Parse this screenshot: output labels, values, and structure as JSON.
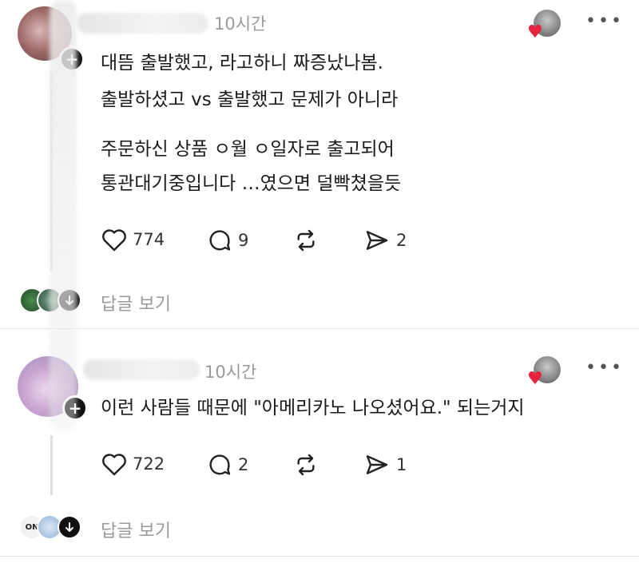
{
  "comments": [
    {
      "time": "10시간",
      "lines": [
        "대뜸 출발했고, 라고하니 짜증났나봄.",
        "출발하셨고 vs 출발했고 문제가 아니라",
        "주문하신 상품 ㅇ월 ㅇ일자로 출고되어",
        "통관대기중입니다 …였으면 덜빡쳤을듯"
      ],
      "likes": "774",
      "replies": "9",
      "shares": "2",
      "reply_link": "답글 보기"
    },
    {
      "time": "10시간",
      "lines": [
        "이런 사람들 때문에 \"아메리카노 나오셨어요.\" 되는거지"
      ],
      "likes": "722",
      "replies": "2",
      "shares": "1",
      "reply_link": "답글 보기",
      "reply_avatar_text": "ON"
    }
  ],
  "icons": {
    "like": "heart-outline-icon",
    "comment": "speech-bubble-icon",
    "repost": "repost-arrows-icon",
    "share": "paper-plane-icon",
    "more": "more-dots-icon",
    "liked": "heart-filled-icon"
  },
  "colors": {
    "heart": "#e8213d",
    "muted": "#9a9a9a"
  }
}
